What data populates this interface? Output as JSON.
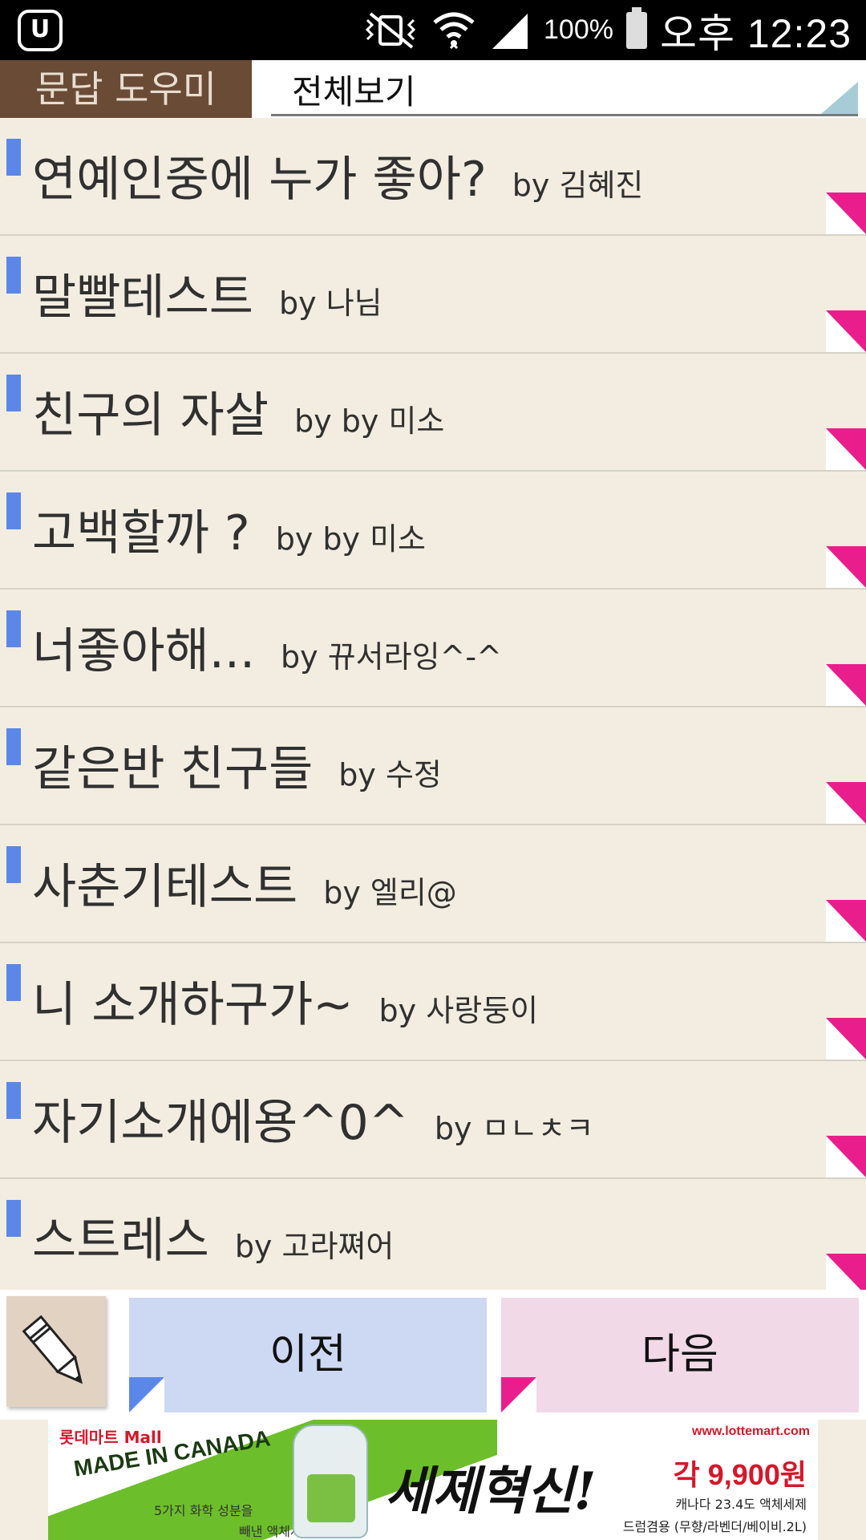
{
  "status_bar": {
    "carrier_icon": "u-plus-logo-icon",
    "mute_icon": "vibrate-mute-icon",
    "wifi_icon": "wifi-icon",
    "signal_icon": "signal-icon",
    "battery_level": "100%",
    "battery_icon": "battery-icon",
    "time": "오후 12:23"
  },
  "header": {
    "app_title": "문답 도우미",
    "filter_value": "전체보기"
  },
  "list": {
    "items": [
      {
        "title": "연예인중에 누가 좋아?",
        "author": "by 김혜진"
      },
      {
        "title": "말빨테스트",
        "author": "by 나님"
      },
      {
        "title": "친구의 자살",
        "author": "by by 미소"
      },
      {
        "title": "고백할까 ?",
        "author": "by by 미소"
      },
      {
        "title": "너좋아해...",
        "author": "by 뀨서라잉^-^"
      },
      {
        "title": "같은반 친구들",
        "author": "by 수정"
      },
      {
        "title": "사춘기테스트",
        "author": "by 엘리@"
      },
      {
        "title": "니 소개하구가~",
        "author": "by 사랑둥이"
      },
      {
        "title": "자기소개에용^0^",
        "author": "by ㅁㄴㅊㅋ"
      },
      {
        "title": "스트레스",
        "author": "by 고라쪄어"
      }
    ]
  },
  "controls": {
    "write_icon": "pencil-icon",
    "prev_label": "이전",
    "next_label": "다음"
  },
  "ad": {
    "brand": "롯데마트 Mall",
    "made_in": "MADE IN CANADA",
    "sub1": "5가지 화학 성분을",
    "sub2": "빼낸 액체세제!",
    "headline": "세제혁신!",
    "url": "www.lottemart.com",
    "price": "각 9,900원",
    "note1": "캐나다 23.4도 액체세제",
    "note2": "드럼겸용 (무향/라벤더/베이비.2L)"
  }
}
